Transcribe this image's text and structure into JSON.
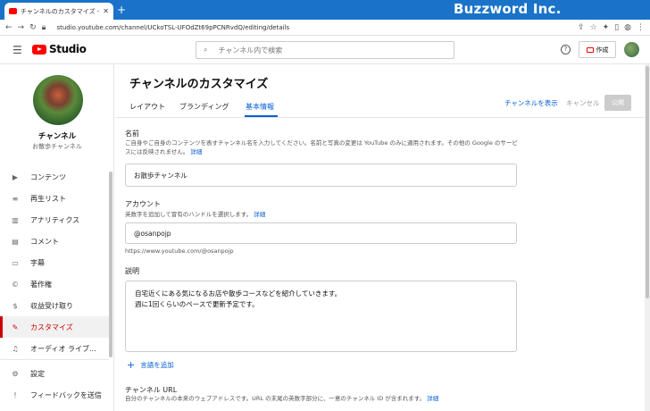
{
  "browser": {
    "tab_title": "チャンネルのカスタマイズ - YouTube S",
    "new_tab": "+",
    "brand": "Buzzword Inc.",
    "url": "studio.youtube.com/channel/UCkoTSL-UFOdZt69pPCNRvdQ/editing/details"
  },
  "header": {
    "logo_text": "Studio",
    "search_placeholder": "チャンネル内で検索",
    "help": "?",
    "create_label": "作成"
  },
  "sidebar": {
    "channel_name": "チャンネル",
    "channel_sub": "お散歩チャンネル",
    "items": [
      {
        "label": "コンテンツ",
        "icon": "▶"
      },
      {
        "label": "再生リスト",
        "icon": "≡"
      },
      {
        "label": "アナリティクス",
        "icon": "▥"
      },
      {
        "label": "コメント",
        "icon": "▤"
      },
      {
        "label": "字幕",
        "icon": "▭"
      },
      {
        "label": "著作権",
        "icon": "©"
      },
      {
        "label": "収益受け取り",
        "icon": "$"
      },
      {
        "label": "カスタマイズ",
        "icon": "✎"
      },
      {
        "label": "オーディオ ライブ...",
        "icon": "♫"
      },
      {
        "label": "設定",
        "icon": "⚙"
      },
      {
        "label": "フィードバックを送信",
        "icon": "!"
      }
    ]
  },
  "main": {
    "title": "チャンネルのカスタマイズ",
    "tabs": [
      "レイアウト",
      "ブランディング",
      "基本情報"
    ],
    "view_channel": "チャンネルを表示",
    "cancel": "キャンセル",
    "publish": "公開",
    "name": {
      "label": "名前",
      "desc": "ご自身やご自身のコンテンツを表すチャンネル名を入力してください。名前と写真の変更は YouTube のみに適用されます。その他の Google のサービスには反映されません。",
      "link": "詳細",
      "value": "お散歩チャンネル"
    },
    "account": {
      "label": "アカウント",
      "desc": "英数字を追加して冒有のハンドルを選択します。",
      "link": "詳細",
      "value": "@osanpojp",
      "url_hint": "https://www.youtube.com/@osanpojp"
    },
    "description": {
      "label": "説明",
      "line1": "自宅近くにある気になるお店や散歩コースなどを紹介していきます。",
      "line2": "週に1回くらいのペースで更新予定です。"
    },
    "add_language": "言語を追加",
    "channel_url": {
      "label": "チャンネル URL",
      "desc": "自分のチャンネルの本来のウェブアドレスです。URL の末尾の英数字部分に、一意のチャンネル ID が含まれます。",
      "link": "詳細"
    }
  }
}
